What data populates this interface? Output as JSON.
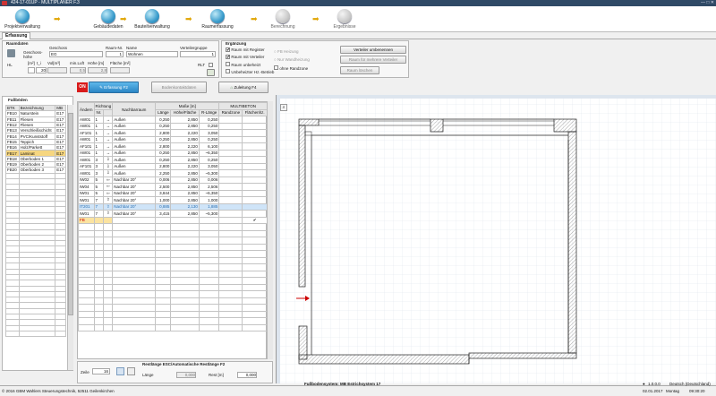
{
  "window": {
    "title": "424-17-01UP - MULTIPLANER F.3",
    "controls": "—  □  ✕"
  },
  "toolbar": {
    "steps": [
      {
        "label": "Projektverwaltung",
        "active": true
      },
      {
        "label": "Gebäudedaten",
        "active": true
      },
      {
        "label": "Bauteilverwaltung",
        "active": true
      },
      {
        "label": "Raumerfassung",
        "active": true
      },
      {
        "label": "Berechnung",
        "active": false
      },
      {
        "label": "Ergebnisse",
        "active": false
      }
    ]
  },
  "tab": "Erfassung",
  "raumdaten": {
    "header": "Raumdaten",
    "geschoss_label": "Geschoss",
    "geschoss_value": "EG",
    "geschoss_side": "Geschoss-",
    "geschoss_side2": "höhe",
    "raum_nr_label": "Raum-Nr.",
    "raum_nr": "1",
    "name_label": "Name",
    "name": "Wohnen",
    "verteiler_label": "Verteilergruppe",
    "verteiler": "1",
    "h_label": "HL",
    "row2_labels": [
      "[m²]",
      "t_i",
      "Vol[m³]",
      "min.Luft",
      "Höhe [m]",
      "Fläche [m²]"
    ],
    "row2_values": [
      "",
      "20",
      "",
      "0,5",
      "2,8",
      ""
    ],
    "rlt_label": "RLT"
  },
  "erganzung": {
    "header": "Ergänzung",
    "checks": [
      {
        "label": "Raum mit Register",
        "checked": true
      },
      {
        "label": "Raum mit Verteiler",
        "checked": true
      },
      {
        "label": "Raum unbeheizt",
        "checked": false
      },
      {
        "label": "Unbeheizter Hz.-Betrieb",
        "checked": false
      }
    ],
    "options": [
      {
        "label": "FB Heizung",
        "enabled": false
      },
      {
        "label": "Nur Wandheizung",
        "enabled": false
      },
      {
        "label": "ohne Randzone",
        "enabled": true
      }
    ],
    "buttons": [
      {
        "label": "Verteiler umbenennen",
        "enabled": true
      },
      {
        "label": "Raum für mehrere Verteiler",
        "enabled": false
      },
      {
        "label": "Raum löschen",
        "enabled": false
      }
    ]
  },
  "actions": {
    "on_label": "ON",
    "erfassung": "Erfassung F2",
    "bodenkontaktdaten": "Bodenkontaktdaten",
    "zuleitung": "Zuleitung F4"
  },
  "fussboden": {
    "header": "Fußböden",
    "columns": [
      "BTK",
      "Bezeichnung",
      "MB"
    ],
    "rows": [
      [
        "FB10",
        "Naturstein",
        "E17"
      ],
      [
        "FB11",
        "Fliesen",
        "E17"
      ],
      [
        "FB12",
        "Fliesen",
        "E17"
      ],
      [
        "FB13",
        "Verschleißschicht",
        "E17"
      ],
      [
        "FB14",
        "PVC/Kunststoff",
        "E17"
      ],
      [
        "FB15",
        "Teppich",
        "E17"
      ],
      [
        "FB16",
        "Holz/Parkett",
        "E17"
      ],
      [
        "FB17",
        "Laminat",
        "E17"
      ],
      [
        "FB18",
        "Oberboden 1",
        "E17"
      ],
      [
        "FB19",
        "Oberboden 2",
        "E17"
      ],
      [
        "FB20",
        "Oberboden 3",
        "E17"
      ]
    ],
    "selected": 7
  },
  "walls": {
    "headers": {
      "andern": "Ändern",
      "richtung": "Richtung",
      "nr": "Nr.",
      "nachbarraum": "Nachbarraum",
      "masse": "Maße [m]",
      "laenge": "Länge",
      "hoehe": "Höhe/Fläche",
      "rl": "R-Länge",
      "multibeton": "MULTIBETON",
      "randzone": "Randzone",
      "flaechenhz": "Flächenhz."
    },
    "rows": [
      {
        "a": "AW01",
        "n": "1",
        "d": "→",
        "nb": "Außen",
        "l": "0,250",
        "h": "2,850",
        "r": "0,250",
        "bold": false,
        "sel": false
      },
      {
        "a": "AW01",
        "n": "1",
        "d": "→",
        "nb": "Außen",
        "l": "0,250",
        "h": "2,850",
        "r": "0,250",
        "bold": false,
        "sel": false
      },
      {
        "a": "AF101",
        "n": "1",
        "d": "→",
        "nb": "Außen",
        "l": "2,800",
        "h": "2,220",
        "r": "3,050",
        "bold": false,
        "sel": false
      },
      {
        "a": "AW01",
        "n": "1",
        "d": "→",
        "nb": "Außen",
        "l": "0,250",
        "h": "2,850",
        "r": "0,250",
        "bold": false,
        "sel": false
      },
      {
        "a": "AF101",
        "n": "1",
        "d": "→",
        "nb": "Außen",
        "l": "2,800",
        "h": "2,220",
        "r": "6,100",
        "bold": false,
        "sel": false
      },
      {
        "a": "AW01",
        "n": "1",
        "d": "→",
        "nb": "Außen",
        "l": "0,250",
        "h": "2,850",
        "r": "~6,350",
        "bold": true,
        "sel": false
      },
      {
        "a": "AW01",
        "n": "3",
        "d": "⇩",
        "nb": "Außen",
        "l": "0,250",
        "h": "2,850",
        "r": "0,250",
        "bold": false,
        "sel": false
      },
      {
        "a": "AF101",
        "n": "3",
        "d": "⇩",
        "nb": "Außen",
        "l": "2,800",
        "h": "2,220",
        "r": "3,050",
        "bold": false,
        "sel": false
      },
      {
        "a": "AW01",
        "n": "3",
        "d": "⇩",
        "nb": "Außen",
        "l": "2,250",
        "h": "2,850",
        "r": "~5,300",
        "bold": true,
        "sel": false
      },
      {
        "a": "IW02",
        "n": "5",
        "d": "⇦",
        "nb": "Nachbar 20°",
        "l": "0,006",
        "h": "2,850",
        "r": "0,006",
        "bold": false,
        "sel": false
      },
      {
        "a": "IW04",
        "n": "5",
        "d": "⇦",
        "nb": "Nachbar 20°",
        "l": "2,500",
        "h": "2,850",
        "r": "2,506",
        "bold": false,
        "sel": false
      },
      {
        "a": "IW01",
        "n": "5",
        "d": "⇦",
        "nb": "Nachbar 20°",
        "l": "3,844",
        "h": "2,850",
        "r": "~6,350",
        "bold": true,
        "sel": false
      },
      {
        "a": "IW01",
        "n": "7",
        "d": "⇧",
        "nb": "Nachbar 20°",
        "l": "1,000",
        "h": "2,850",
        "r": "1,000",
        "bold": false,
        "sel": false
      },
      {
        "a": "IT201",
        "n": "7",
        "d": "⇧",
        "nb": "Nachbar 20°",
        "l": "0,885",
        "h": "2,130",
        "r": "1,885",
        "bold": false,
        "sel": true
      },
      {
        "a": "IW01",
        "n": "7",
        "d": "⇧",
        "nb": "Nachbar 20°",
        "l": "3,415",
        "h": "2,850",
        "r": "~5,300",
        "bold": true,
        "sel": false
      }
    ],
    "fb_row": {
      "a": "FB",
      "check": "✔"
    }
  },
  "restlaenge": {
    "header": "Restlänge ESC/Automatische Restlänge F2",
    "zeile_label": "Zeile",
    "zeile": "16",
    "laenge_label": "Länge",
    "laenge": "0,000",
    "rest_label": "Rest [m]",
    "rest": "0,000"
  },
  "plan": {
    "zoom_icon": "magnifier-icon"
  },
  "status": {
    "left": "© 2016 GBM Wahlers Steuerungstechnik, 52511 Geilenkirchen",
    "center": "Fußbodensystem: MB Estrichsystem 17",
    "version": "1.0.0.0",
    "lang": "Deutsch (Deutschland)",
    "date": "02.01.2017",
    "day": "Montag",
    "time": "09:30:20"
  }
}
